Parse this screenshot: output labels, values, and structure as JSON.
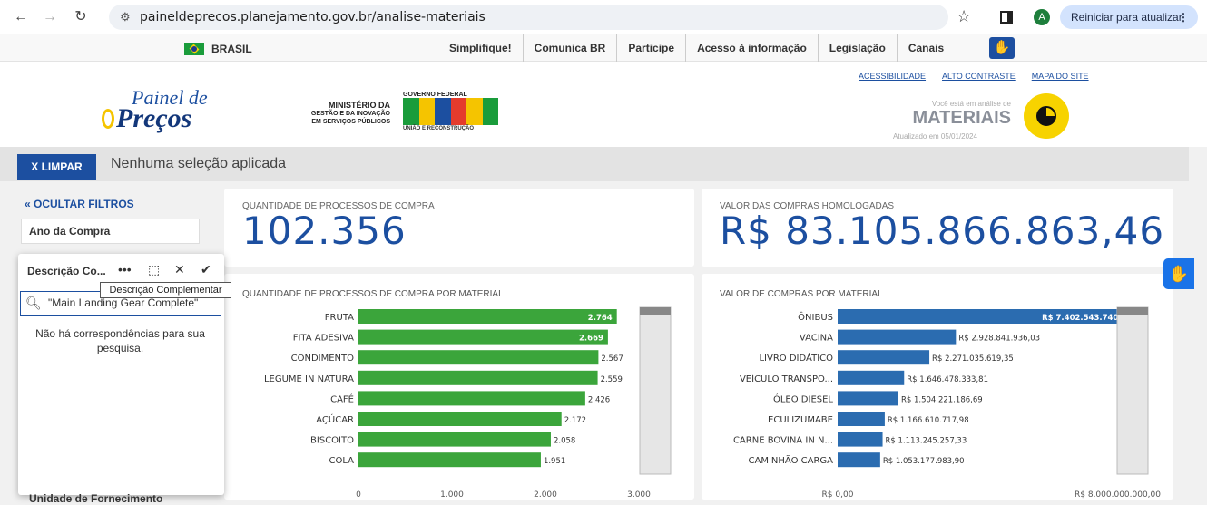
{
  "browser": {
    "url": "paineldeprecos.planejamento.gov.br/analise-materiais",
    "avatar_letter": "A",
    "update_label": "Reiniciar para atualizar"
  },
  "govbar": {
    "country": "BRASIL",
    "links": [
      "Simplifique!",
      "Comunica BR",
      "Participe",
      "Acesso à informação",
      "Legislação",
      "Canais"
    ]
  },
  "header": {
    "logo_line1": "Painel de",
    "logo_line2": "Preços",
    "ministry_line1": "MINISTÉRIO DA",
    "ministry_line2": "GESTÃO E DA INOVAÇÃO",
    "ministry_line3": "EM SERVIÇOS PÚBLICOS",
    "gov_federal": "GOVERNO FEDERAL",
    "uniao": "UNIÃO E RECONSTRUÇÃO",
    "links": [
      "ACESSIBILIDADE",
      "ALTO CONTRASTE",
      "MAPA DO SITE"
    ],
    "analysis_label": "Você está em análise de",
    "analysis_value": "MATERIAIS",
    "updated": "Atualizado em 05/01/2024"
  },
  "selection": {
    "clear_label": "X LIMPAR",
    "status": "Nenhuma seleção aplicada"
  },
  "filters": {
    "hide_label": "OCULTAR FILTROS",
    "year_label": "Ano da Compra",
    "popup_title": "Descrição Co...",
    "tooltip": "Descrição Complementar",
    "search_value": "\"Main Landing Gear Complete\"",
    "no_match": "Não há correspondências para sua pesquisa.",
    "next_filter": "Unidade de Fornecimento"
  },
  "kpis": {
    "qty_label": "QUANTIDADE DE PROCESSOS DE COMPRA",
    "qty_value": "102.356",
    "value_label": "VALOR DAS COMPRAS HOMOLOGADAS",
    "value_value": "R$ 83.105.866.863,46"
  },
  "colors": {
    "green": "#3ba53b",
    "blue": "#2b6cb0",
    "primary": "#1c4fa0"
  },
  "chart_data": [
    {
      "type": "bar",
      "title": "QUANTIDADE DE PROCESSOS DE COMPRA POR MATERIAL",
      "orientation": "horizontal",
      "categories": [
        "FRUTA",
        "FITA ADESIVA",
        "CONDIMENTO",
        "LEGUME IN NATURA",
        "CAFÉ",
        "AÇÚCAR",
        "BISCOITO",
        "COLA"
      ],
      "values": [
        2764,
        2669,
        2567,
        2559,
        2426,
        2172,
        2058,
        1951
      ],
      "value_labels": [
        "2.764",
        "2.669",
        "2.567",
        "2.559",
        "2.426",
        "2.172",
        "2.058",
        "1.951"
      ],
      "ticks": [
        "0",
        "1.000",
        "2.000",
        "3.000"
      ],
      "xlim": [
        0,
        3000
      ]
    },
    {
      "type": "bar",
      "title": "VALOR DE COMPRAS POR MATERIAL",
      "orientation": "horizontal",
      "categories": [
        "ÔNIBUS",
        "VACINA",
        "LIVRO DIDÁTICO",
        "VEÍCULO TRANSPO...",
        "ÓLEO DIESEL",
        "ECULIZUMABE",
        "CARNE BOVINA IN N...",
        "CAMINHÃO CARGA"
      ],
      "values": [
        7402543740.0,
        2928841936.03,
        2271035619.35,
        1646478333.81,
        1504221186.69,
        1166610717.98,
        1113245257.33,
        1053177983.9
      ],
      "value_labels": [
        "R$ 7.402.543.740,00",
        "R$ 2.928.841.936,03",
        "R$ 2.271.035.619,35",
        "R$ 1.646.478.333,81",
        "R$ 1.504.221.186,69",
        "R$ 1.166.610.717,98",
        "R$ 1.113.245.257,33",
        "R$ 1.053.177.983,90"
      ],
      "ticks": [
        "R$ 0,00",
        "R$ 8.000.000.000,00"
      ],
      "xlim": [
        0,
        8000000000
      ]
    }
  ]
}
